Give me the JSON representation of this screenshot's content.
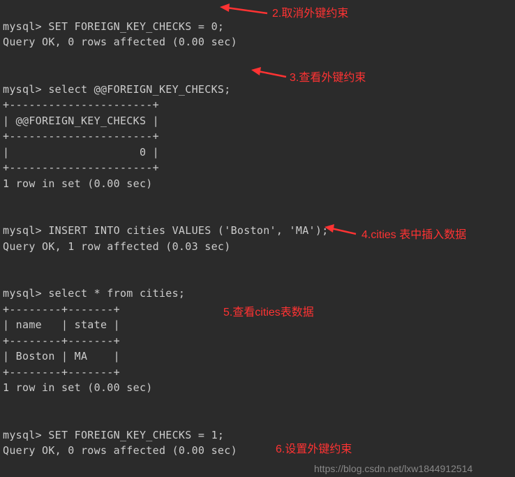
{
  "terminal": {
    "line1": "mysql> SET FOREIGN_KEY_CHECKS = 0;",
    "line2": "Query OK, 0 rows affected (0.00 sec)",
    "blank1": "",
    "blank2": "",
    "line3": "mysql> select @@FOREIGN_KEY_CHECKS;",
    "line4": "+----------------------+",
    "line5": "| @@FOREIGN_KEY_CHECKS |",
    "line6": "+----------------------+",
    "line7": "|                    0 |",
    "line8": "+----------------------+",
    "line9": "1 row in set (0.00 sec)",
    "blank3": "",
    "blank4": "",
    "line10": "mysql> INSERT INTO cities VALUES ('Boston', 'MA');",
    "line11": "Query OK, 1 row affected (0.03 sec)",
    "blank5": "",
    "blank6": "",
    "line12": "mysql> select * from cities;",
    "line13": "+--------+-------+",
    "line14": "| name   | state |",
    "line15": "+--------+-------+",
    "line16": "| Boston | MA    |",
    "line17": "+--------+-------+",
    "line18": "1 row in set (0.00 sec)",
    "blank7": "",
    "blank8": "",
    "line19": "mysql> SET FOREIGN_KEY_CHECKS = 1;",
    "line20": "Query OK, 0 rows affected (0.00 sec)"
  },
  "annotations": {
    "a2": "2.取消外键约束",
    "a3": "3.查看外键约束",
    "a4": "4.cities 表中插入数据",
    "a5": "5.查看cities表数据",
    "a6": "6.设置外键约束"
  },
  "watermark": "https://blog.csdn.net/lxw1844912514"
}
